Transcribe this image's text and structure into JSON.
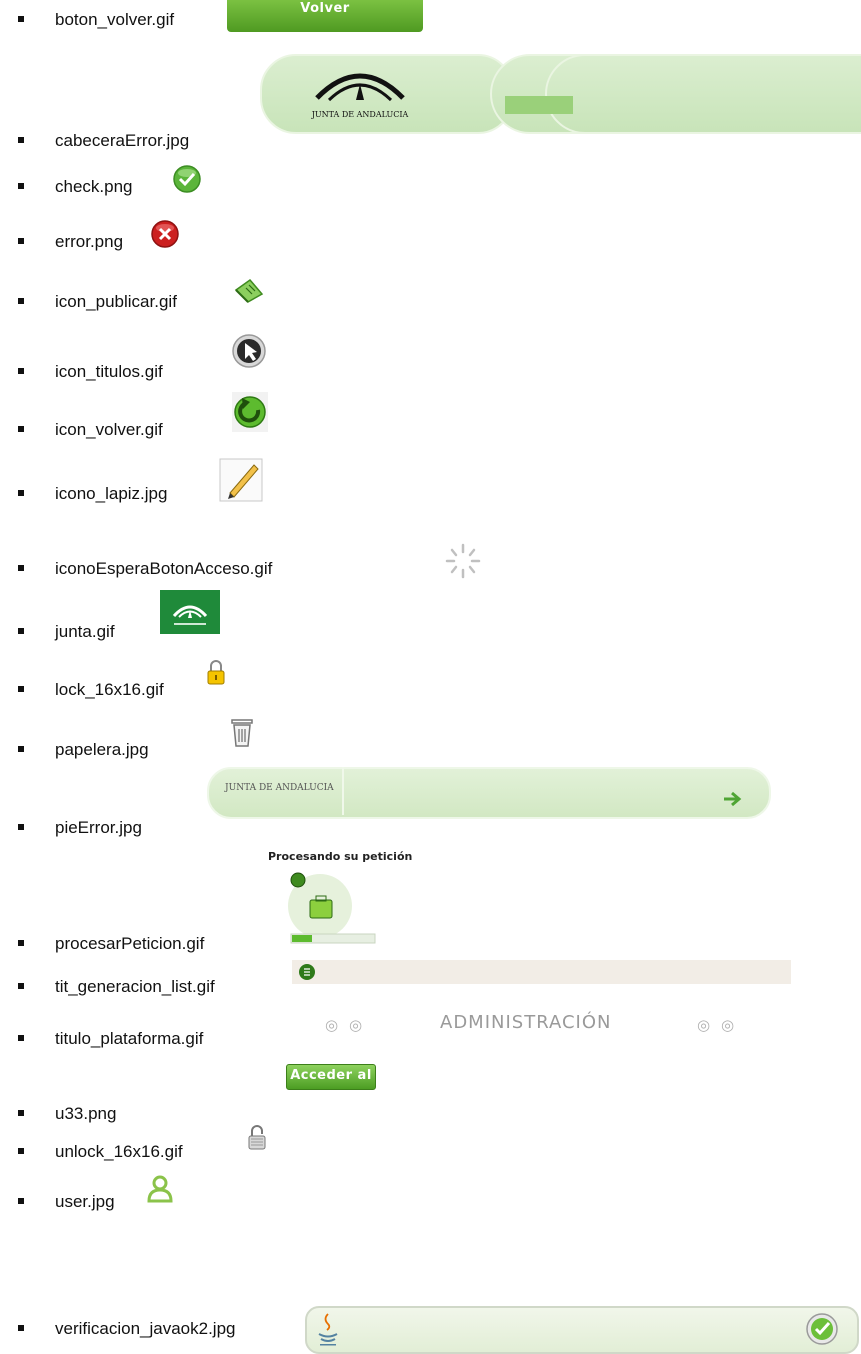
{
  "files": [
    {
      "name": "boton_volver.gif",
      "button_text": "Volver"
    },
    {
      "name": "cabeceraError.jpg",
      "logo_text": "JUNTA DE ANDALUCIA"
    },
    {
      "name": "check.png"
    },
    {
      "name": "error.png"
    },
    {
      "name": "icon_publicar.gif"
    },
    {
      "name": "icon_titulos.gif"
    },
    {
      "name": "icon_volver.gif"
    },
    {
      "name": "icono_lapiz.jpg"
    },
    {
      "name": "iconoEsperaBotonAcceso.gif"
    },
    {
      "name": "junta.gif"
    },
    {
      "name": "lock_16x16.gif"
    },
    {
      "name": "papelera.jpg"
    },
    {
      "name": "pieError.jpg",
      "logo_text": "JUNTA DE ANDALUCIA"
    },
    {
      "name": "procesarPeticion.gif",
      "caption": "Procesando su petición"
    },
    {
      "name": "tit_generacion_list.gif"
    },
    {
      "name": "titulo_plataforma.gif",
      "title_text": "ADMINISTRACIÓN"
    },
    {
      "name": "u33.png",
      "button_text": "Acceder al sistema"
    },
    {
      "name": "unlock_16x16.gif"
    },
    {
      "name": "user.jpg"
    },
    {
      "name": "verificacion_javaok2.jpg"
    }
  ],
  "icons": {
    "check": "check-icon",
    "error": "error-icon",
    "publicar": "publish-icon",
    "titulos": "cursor-icon",
    "volver": "return-arrow-icon",
    "lapiz": "pencil-icon",
    "espera": "spinner-icon",
    "lock": "lock-icon",
    "unlock": "unlock-icon",
    "papelera": "trash-icon",
    "user": "user-icon",
    "java": "java-icon"
  },
  "colors": {
    "green": "#4f9a22",
    "light_green": "#d6ecc8",
    "red": "#cc1f1f"
  }
}
